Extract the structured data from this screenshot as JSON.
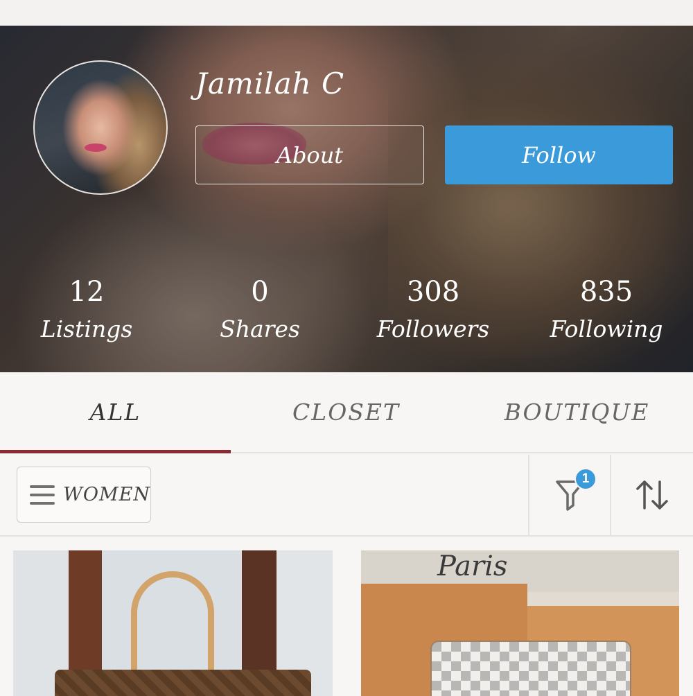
{
  "profile": {
    "name": "Jamilah C",
    "about_label": "About",
    "follow_label": "Follow"
  },
  "stats": [
    {
      "value": "12",
      "label": "Listings"
    },
    {
      "value": "0",
      "label": "Shares"
    },
    {
      "value": "308",
      "label": "Followers"
    },
    {
      "value": "835",
      "label": "Following"
    }
  ],
  "tabs": [
    {
      "label": "ALL",
      "active": true
    },
    {
      "label": "CLOSET",
      "active": false
    },
    {
      "label": "BOUTIQUE",
      "active": false
    }
  ],
  "filters": {
    "department_label": "WOMEN",
    "filter_count": "1",
    "menu_icon": "hamburger-icon",
    "filter_icon": "funnel-icon",
    "sort_icon": "sort-arrows-icon"
  },
  "listings": [
    {
      "image": "tan-handled-monogram-tote"
    },
    {
      "image": "checkered-pouch-with-boxes",
      "sign_text": "Paris"
    }
  ],
  "colors": {
    "follow_button": "#3b9ad9",
    "active_tab_underline": "#8a2a35",
    "badge": "#3b9ad9"
  }
}
